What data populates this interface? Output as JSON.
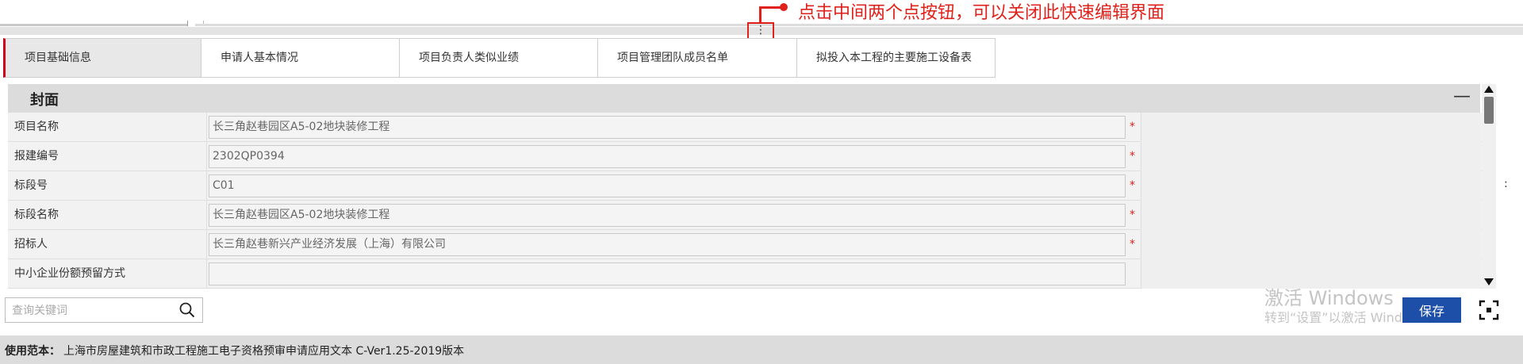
{
  "annotation": {
    "text": "点击中间两个点按钮，可以关闭此快速编辑界面"
  },
  "splitter": {
    "glyph": "⋮"
  },
  "tabs": [
    {
      "label": "项目基础信息",
      "active": true
    },
    {
      "label": "申请人基本情况",
      "active": false
    },
    {
      "label": "项目负责人类似业绩",
      "active": false
    },
    {
      "label": "项目管理团队成员名单",
      "active": false
    },
    {
      "label": "拟投入本工程的主要施工设备表",
      "active": false
    }
  ],
  "section": {
    "title": "封面",
    "collapse_glyph": "—"
  },
  "form": {
    "required_mark": "*",
    "rows": [
      {
        "label": "项目名称",
        "value": "长三角赵巷园区A5-02地块装修工程"
      },
      {
        "label": "报建编号",
        "value": "2302QP0394"
      },
      {
        "label": "标段号",
        "value": "C01"
      },
      {
        "label": "标段名称",
        "value": "长三角赵巷园区A5-02地块装修工程"
      },
      {
        "label": "招标人",
        "value": "长三角赵巷新兴产业经济发展（上海）有限公司"
      },
      {
        "label": "中小企业份额预留方式",
        "value": ""
      }
    ]
  },
  "right_handle": ":",
  "search": {
    "placeholder": "查询关键词"
  },
  "watermark": {
    "line1": "激活 Windows",
    "line2": "转到“设置”以激活 Windows。"
  },
  "toolbar": {
    "save_label": "保存"
  },
  "footer": {
    "label": "使用范本：",
    "text": "上海市房屋建筑和市政工程施工电子资格预审申请应用文本  C-Ver1.25-2019版本"
  },
  "colors": {
    "accent_red": "#e0201a",
    "save_blue": "#1d4fa8",
    "active_tab_border": "#d0021b"
  }
}
